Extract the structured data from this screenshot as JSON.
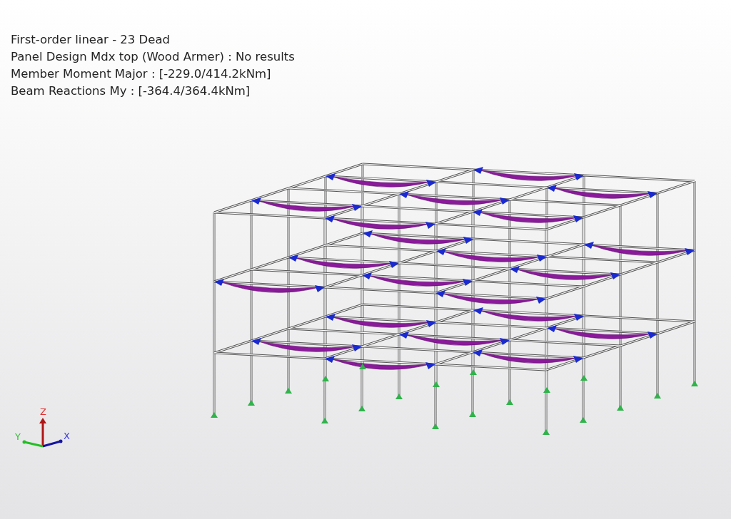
{
  "result_info": {
    "lines": [
      "First-order linear - 23 Dead",
      "Panel Design Mdx top (Wood Armer) : No results",
      "Member Moment Major  : [-229.0/414.2kNm]",
      "Beam Reactions My :  [-364.4/364.4kNm]"
    ]
  },
  "axis_triad": {
    "z_label": "Z",
    "y_label": "Y",
    "x_label": "X"
  }
}
